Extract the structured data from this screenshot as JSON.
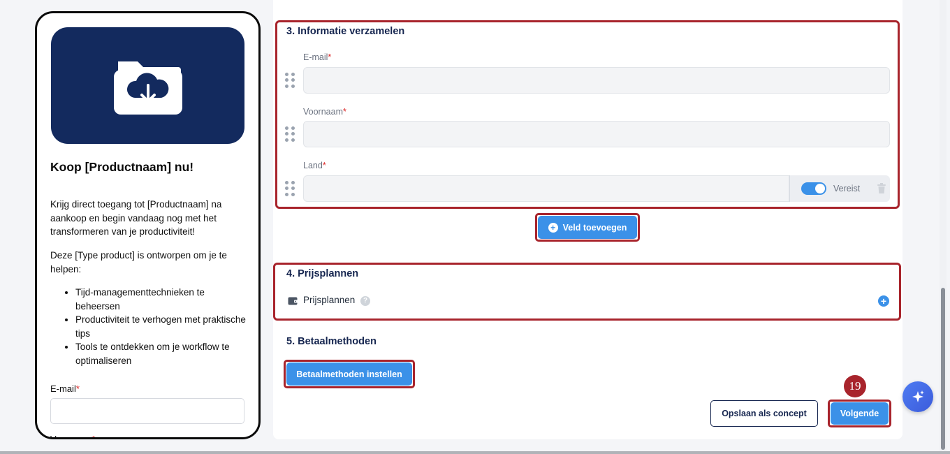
{
  "preview": {
    "title": "Koop [Productnaam] nu!",
    "paragraph1": "Krijg direct toegang tot [Productnaam] na aankoop en begin vandaag nog met het transformeren van je productiviteit!",
    "paragraph2": "Deze [Type product] is ontworpen om je te helpen:",
    "bullets": [
      "Tijd-managementtechnieken te beheersen",
      "Productiviteit te verhogen met praktische tips",
      "Tools te ontdekken om je workflow te optimaliseren"
    ],
    "email_label": "E-mail",
    "name_label": "Voornaam",
    "required_mark": "*",
    "hero_icon": "folder-cloud-download-icon"
  },
  "section3": {
    "title": "3. Informatie verzamelen",
    "fields": [
      {
        "label": "E-mail",
        "value": ""
      },
      {
        "label": "Voornaam",
        "value": ""
      },
      {
        "label": "Land",
        "value": ""
      }
    ],
    "required_mark": "*",
    "required_toggle_label": "Vereist",
    "required_toggle_on": true,
    "add_field_label": "Veld toevoegen"
  },
  "section4": {
    "title": "4. Prijsplannen",
    "row_label": "Prijsplannen",
    "help_glyph": "?",
    "add_glyph": "+"
  },
  "section5": {
    "title": "5. Betaalmethoden",
    "setup_button": "Betaalmethoden instellen"
  },
  "footer": {
    "save_draft": "Opslaan als concept",
    "next": "Volgende",
    "step_number": "19"
  },
  "colors": {
    "primary": "#3b91e8",
    "navy": "#15254f",
    "hero_bg": "#132a5e",
    "highlight": "#a8242c",
    "required": "#dc2626"
  }
}
